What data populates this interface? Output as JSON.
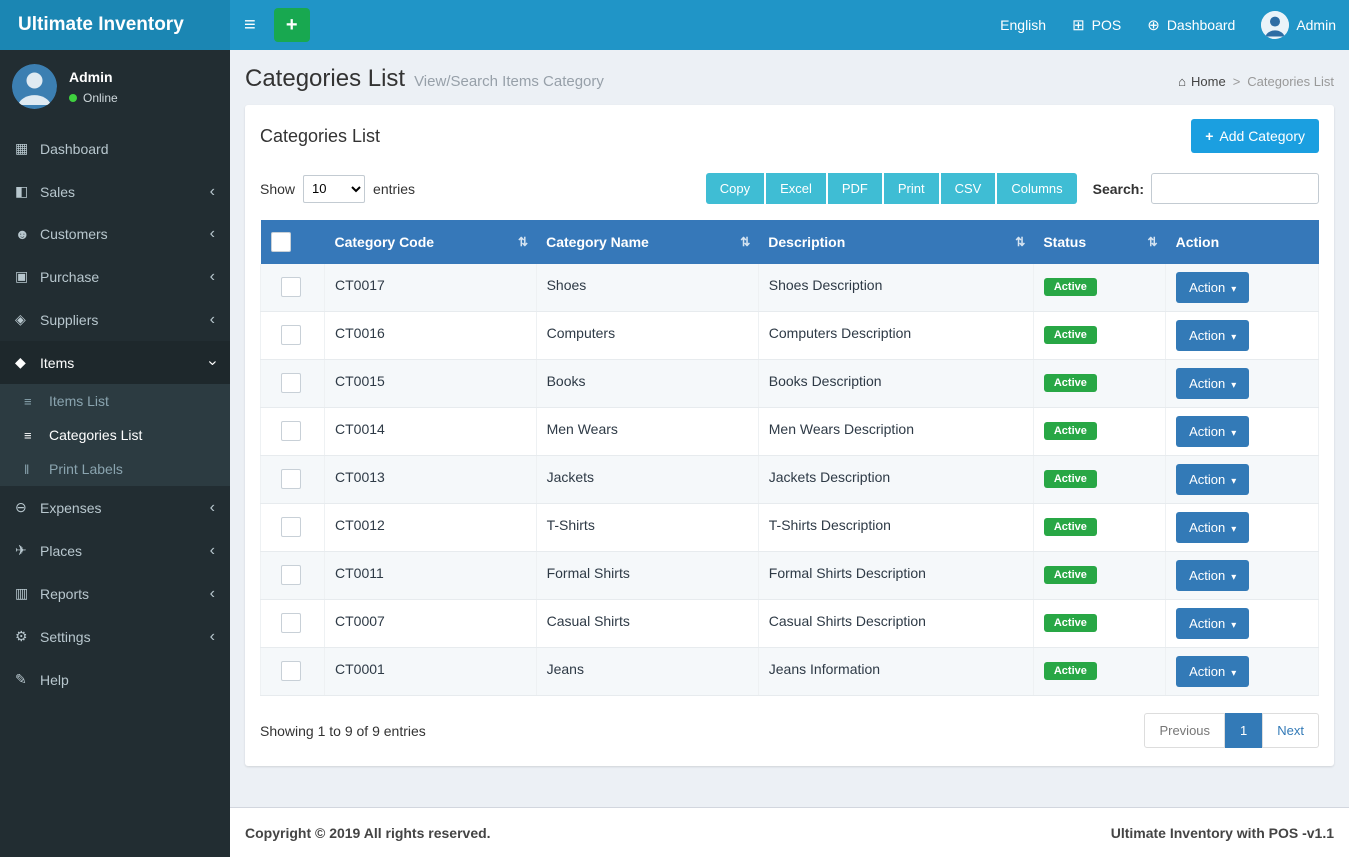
{
  "colors": {
    "navbar": "#2095c7",
    "logo-bg": "#1b86b3",
    "sidebar-bg": "#222d32",
    "sidebar-active-bg": "#1e282c",
    "submenu-bg": "#2c3b41",
    "content-bg": "#ecf0f5",
    "table-header-bg": "#3678b9",
    "primary": "#337ab7",
    "add-button": "#1b9fe0",
    "export-button": "#3fbdd4",
    "success": "#28a745",
    "plus-button": "#18a850",
    "online-dot": "#3fd13f"
  },
  "app": {
    "title": "Ultimate Inventory"
  },
  "navbar": {
    "language": "English",
    "pos": "POS",
    "dashboard": "Dashboard",
    "user": "Admin"
  },
  "sidebar": {
    "user": {
      "name": "Admin",
      "status": "Online"
    },
    "items": [
      {
        "id": "dashboard",
        "label": "Dashboard",
        "icon": "dashboard-icon",
        "chevron": false
      },
      {
        "id": "sales",
        "label": "Sales",
        "icon": "sales-icon",
        "chevron": true
      },
      {
        "id": "customers",
        "label": "Customers",
        "icon": "customers-icon",
        "chevron": true
      },
      {
        "id": "purchase",
        "label": "Purchase",
        "icon": "purchase-icon",
        "chevron": true
      },
      {
        "id": "suppliers",
        "label": "Suppliers",
        "icon": "suppliers-icon",
        "chevron": true
      },
      {
        "id": "items",
        "label": "Items",
        "icon": "items-icon",
        "chevron": true,
        "open": true,
        "active": true,
        "submenu": [
          {
            "id": "items-list",
            "label": "Items List",
            "icon": "list-icon",
            "active": false
          },
          {
            "id": "categories-list",
            "label": "Categories List",
            "icon": "list-icon",
            "active": true
          },
          {
            "id": "print-labels",
            "label": "Print Labels",
            "icon": "barcode-icon",
            "active": false
          }
        ]
      },
      {
        "id": "expenses",
        "label": "Expenses",
        "icon": "expenses-icon",
        "chevron": true
      },
      {
        "id": "places",
        "label": "Places",
        "icon": "places-icon",
        "chevron": true
      },
      {
        "id": "reports",
        "label": "Reports",
        "icon": "reports-icon",
        "chevron": true
      },
      {
        "id": "settings",
        "label": "Settings",
        "icon": "settings-icon",
        "chevron": true
      },
      {
        "id": "help",
        "label": "Help",
        "icon": "help-icon",
        "chevron": false
      }
    ]
  },
  "page": {
    "title": "Categories List",
    "subtitle": "View/Search Items Category",
    "breadcrumb": {
      "home": "Home",
      "separator": ">",
      "current": "Categories List"
    }
  },
  "card": {
    "title": "Categories List",
    "add_button_label": "Add Category"
  },
  "controls": {
    "show_label": "Show",
    "page_length": "10",
    "entries_label": "entries",
    "export_buttons": [
      "Copy",
      "Excel",
      "PDF",
      "Print",
      "CSV",
      "Columns"
    ],
    "search_label": "Search:",
    "search_value": ""
  },
  "table": {
    "headers": [
      {
        "label": "Category Code",
        "sortable": true
      },
      {
        "label": "Category Name",
        "sortable": true
      },
      {
        "label": "Description",
        "sortable": true
      },
      {
        "label": "Status",
        "sortable": true
      },
      {
        "label": "Action",
        "sortable": false
      }
    ],
    "rows": [
      {
        "code": "CT0017",
        "name": "Shoes",
        "description": "Shoes Description",
        "status": "Active",
        "action_label": "Action"
      },
      {
        "code": "CT0016",
        "name": "Computers",
        "description": "Computers Description",
        "status": "Active",
        "action_label": "Action"
      },
      {
        "code": "CT0015",
        "name": "Books",
        "description": "Books Description",
        "status": "Active",
        "action_label": "Action"
      },
      {
        "code": "CT0014",
        "name": "Men Wears",
        "description": "Men Wears Description",
        "status": "Active",
        "action_label": "Action"
      },
      {
        "code": "CT0013",
        "name": "Jackets",
        "description": "Jackets Description",
        "status": "Active",
        "action_label": "Action"
      },
      {
        "code": "CT0012",
        "name": "T-Shirts",
        "description": "T-Shirts Description",
        "status": "Active",
        "action_label": "Action"
      },
      {
        "code": "CT0011",
        "name": "Formal Shirts",
        "description": "Formal Shirts Description",
        "status": "Active",
        "action_label": "Action"
      },
      {
        "code": "CT0007",
        "name": "Casual Shirts",
        "description": "Casual Shirts Description",
        "status": "Active",
        "action_label": "Action"
      },
      {
        "code": "CT0001",
        "name": "Jeans",
        "description": "Jeans Information",
        "status": "Active",
        "action_label": "Action"
      }
    ],
    "info": "Showing 1 to 9 of 9 entries",
    "pagination": {
      "previous": "Previous",
      "pages": [
        "1"
      ],
      "active_page": "1",
      "next": "Next"
    }
  },
  "footer": {
    "copyright": "Copyright © 2019 All rights reserved.",
    "version": "Ultimate Inventory with POS -v1.1"
  }
}
